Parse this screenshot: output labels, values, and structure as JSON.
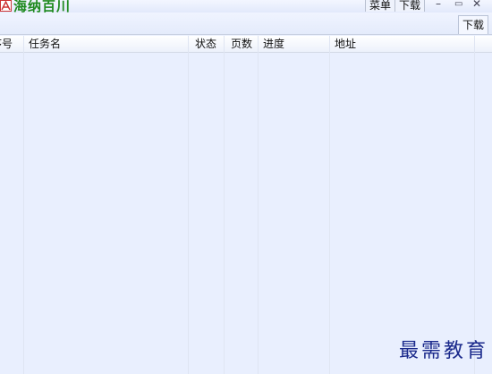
{
  "window": {
    "title": "海纳百川",
    "menu_label": "菜单",
    "download_label": "下载",
    "minimize_glyph": "–",
    "restore_glyph": "▭",
    "close_glyph": "✕"
  },
  "toolbar": {
    "active_tab": "下载"
  },
  "table": {
    "columns": [
      "序号",
      "任务名",
      "状态",
      "页数",
      "进度",
      "地址"
    ],
    "rows": []
  },
  "watermark": "最需教育",
  "colors": {
    "title_green": "#1f8a1f",
    "body_bg": "#e9effe",
    "watermark": "#1b2a8c"
  }
}
